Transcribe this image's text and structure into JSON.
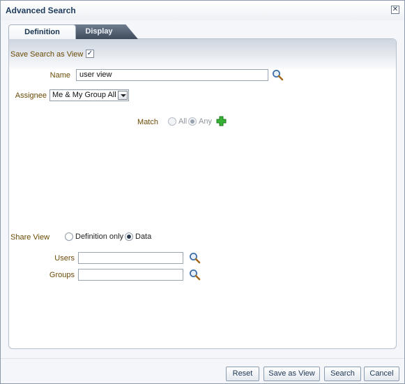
{
  "dialog": {
    "title": "Advanced Search",
    "close_icon": "close-icon"
  },
  "tabs": [
    {
      "label": "Definition",
      "active": true
    },
    {
      "label": "Display",
      "active": false
    }
  ],
  "form": {
    "save_as_view_label": "Save Search as View",
    "save_as_view_checked": true,
    "name_label": "Name",
    "name_value": "user view",
    "assignee_label": "Assignee",
    "assignee_value": "Me & My Group All",
    "match_label": "Match",
    "match_options": [
      "All",
      "Any"
    ],
    "match_selected": "Any",
    "share_view_label": "Share View",
    "share_options": [
      "Definition only",
      "Data"
    ],
    "share_selected": "Data",
    "users_label": "Users",
    "users_value": "",
    "groups_label": "Groups",
    "groups_value": ""
  },
  "buttons": {
    "reset": "Reset",
    "save_as_view": "Save as View",
    "search": "Search",
    "cancel": "Cancel"
  },
  "colors": {
    "title": "#1d3a5c",
    "field_label": "#6b4a06",
    "inactive_tab": "#4a5667",
    "add_icon": "#2fa52f"
  }
}
